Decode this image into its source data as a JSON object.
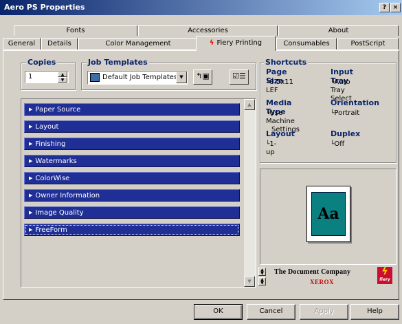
{
  "window": {
    "title": "Aero PS Properties",
    "help_glyph": "?",
    "close_glyph": "×"
  },
  "tabs_row1": [
    "Fonts",
    "Accessories",
    "About"
  ],
  "tabs_row2": [
    "General",
    "Details",
    "Color Management",
    "Fiery Printing",
    "Consumables",
    "PostScript"
  ],
  "active_tab": "Fiery Printing",
  "copies": {
    "label": "Copies",
    "value": "1"
  },
  "job_templates": {
    "label": "Job Templates",
    "selected": "Default Job Templates"
  },
  "features": [
    "Paper Source",
    "Layout",
    "Finishing",
    "Watermarks",
    "ColorWise",
    "Owner Information",
    "Image Quality",
    "FreeForm"
  ],
  "shortcuts": {
    "title": "Shortcuts",
    "page_size": {
      "label": "Page Size",
      "value": "8.5x11 LEF"
    },
    "input_tray": {
      "label": "Input Tray",
      "value": "Auto Tray Select"
    },
    "media_type": {
      "label": "Media Type",
      "value_line1": "Use Machine",
      "value_line2": "Settings"
    },
    "orientation": {
      "label": "Orientation",
      "value": "Portrait"
    },
    "layout": {
      "label": "Layout",
      "value": "1-up"
    },
    "duplex": {
      "label": "Duplex",
      "value": "Off"
    }
  },
  "preview": {
    "sample_text": "Aa"
  },
  "branding": {
    "line1": "The Document Company",
    "line2": "XEROX",
    "fiery": "fiery"
  },
  "buttons": {
    "ok": "OK",
    "cancel": "Cancel",
    "apply": "Apply",
    "help": "Help"
  },
  "colors": {
    "title_start": "#0a246a",
    "title_end": "#a6caf0",
    "feature_bar": "#1f2f96",
    "shortcut_heading": "#0a246a",
    "preview_page": "#0b8080"
  }
}
